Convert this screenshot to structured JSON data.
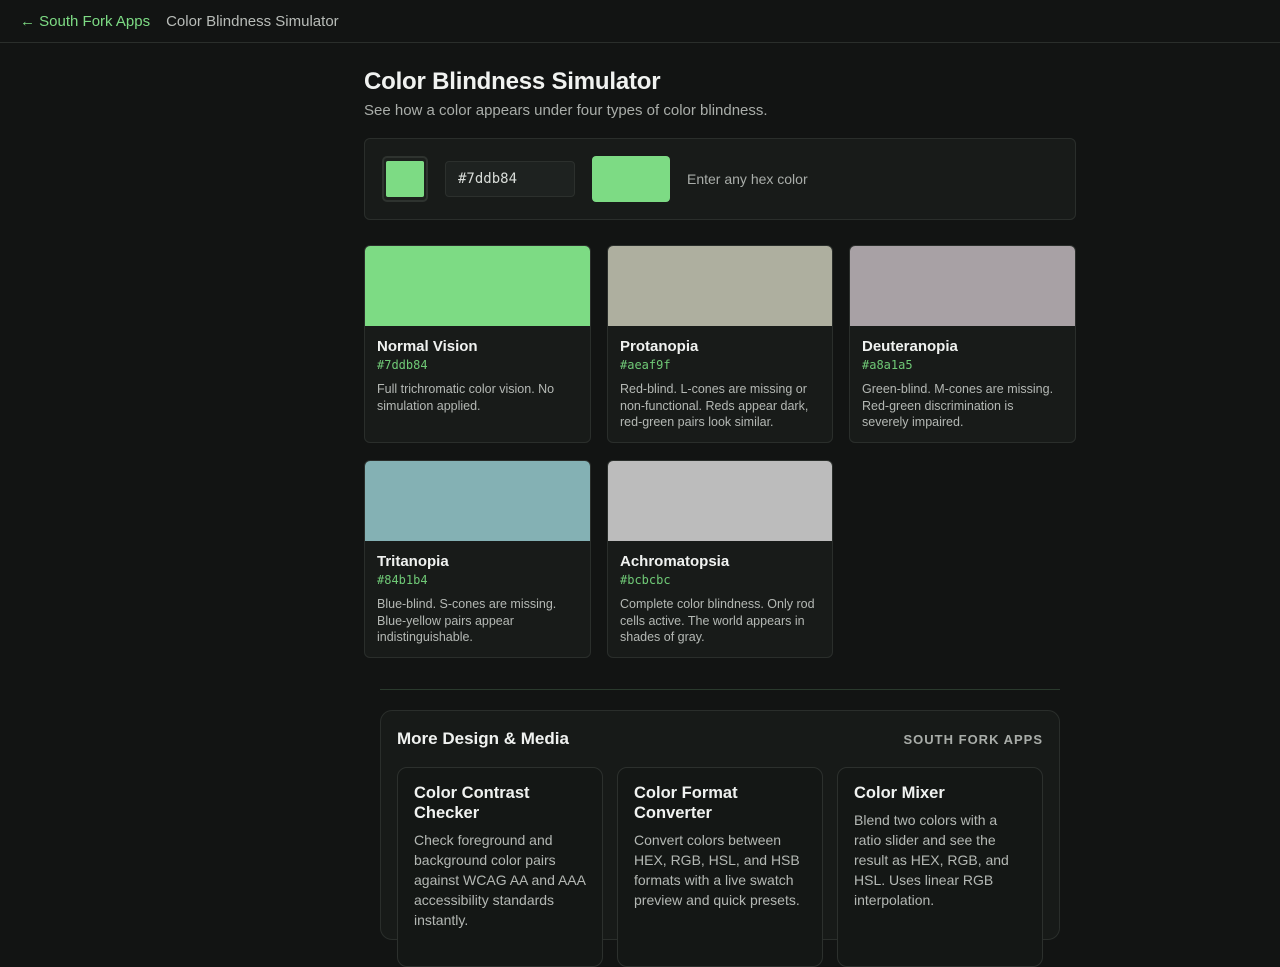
{
  "topbar": {
    "back_label": "← South Fork Apps",
    "crumb": "Color Blindness Simulator"
  },
  "header": {
    "title": "Color Blindness Simulator",
    "subtitle": "See how a color appears under four types of color blindness."
  },
  "picker": {
    "color": "#7ddb84",
    "hex_value": "#7ddb84",
    "hint": "Enter any hex color"
  },
  "cards": [
    {
      "title": "Normal Vision",
      "hex": "#7ddb84",
      "color": "#7ddb84",
      "desc": "Full trichromatic color vision. No simulation applied."
    },
    {
      "title": "Protanopia",
      "hex": "#aeaf9f",
      "color": "#aeaf9f",
      "desc": "Red-blind. L-cones are missing or non-functional. Reds appear dark, red-green pairs look similar."
    },
    {
      "title": "Deuteranopia",
      "hex": "#a8a1a5",
      "color": "#a8a1a5",
      "desc": "Green-blind. M-cones are missing. Red-green discrimination is severely impaired."
    },
    {
      "title": "Tritanopia",
      "hex": "#84b1b4",
      "color": "#84b1b4",
      "desc": "Blue-blind. S-cones are missing. Blue-yellow pairs appear indistinguishable."
    },
    {
      "title": "Achromatopsia",
      "hex": "#bcbcbc",
      "color": "#bcbcbc",
      "desc": "Complete color blindness. Only rod cells active. The world appears in shades of gray."
    }
  ],
  "more": {
    "title": "More Design & Media",
    "brand": "SOUTH FORK APPS",
    "tools": [
      {
        "title": "Color Contrast Checker",
        "desc": "Check foreground and background color pairs against WCAG AA and AAA accessibility standards instantly."
      },
      {
        "title": "Color Format Converter",
        "desc": "Convert colors between HEX, RGB, HSL, and HSB formats with a live swatch preview and quick presets."
      },
      {
        "title": "Color Mixer",
        "desc": "Blend two colors with a ratio slider and see the result as HEX, RGB, and HSL. Uses linear RGB interpolation."
      }
    ]
  }
}
